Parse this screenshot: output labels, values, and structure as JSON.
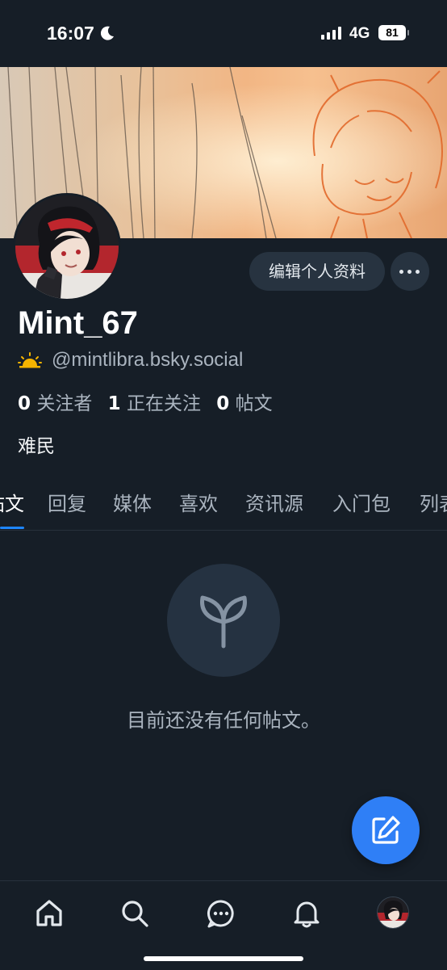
{
  "status_bar": {
    "time": "16:07",
    "network": "4G",
    "battery": "81"
  },
  "profile": {
    "display_name": "Mint_67",
    "handle": "@mintlibra.bsky.social",
    "followers_count": "0",
    "followers_label": "关注者",
    "following_count": "1",
    "following_label": "正在关注",
    "posts_count": "0",
    "posts_label": "帖文",
    "bio": "难民",
    "edit_button": "编辑个人资料"
  },
  "tabs": [
    "帖文",
    "回复",
    "媒体",
    "喜欢",
    "资讯源",
    "入门包",
    "列表"
  ],
  "active_tab": 0,
  "empty_state": {
    "message": "目前还没有任何帖文。",
    "icon": "sprout-icon"
  },
  "bottom_nav": [
    "home-icon",
    "search-icon",
    "chat-icon",
    "bell-icon",
    "avatar"
  ],
  "colors": {
    "accent": "#1e86ff",
    "fab": "#2f7ff6",
    "background": "#161e27",
    "muted": "#aab4bf"
  }
}
